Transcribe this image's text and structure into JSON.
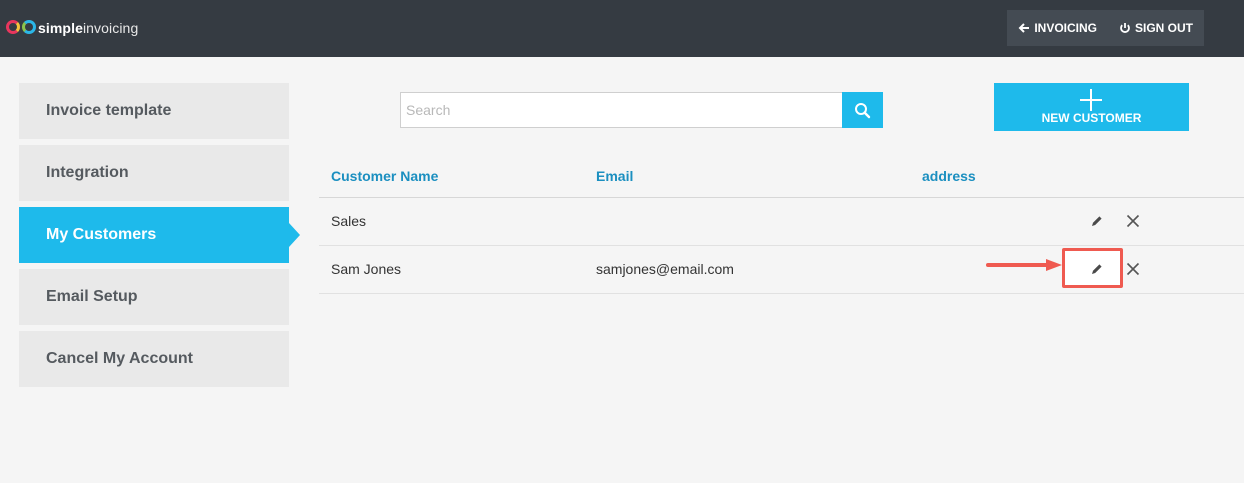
{
  "app": {
    "logo_prefix": "simple",
    "logo_suffix": "invoicing",
    "logo_mark": "GO",
    "accent_color": "#1ebaeb"
  },
  "topnav": {
    "invoicing_label": "INVOICING",
    "invoicing_icon": "arrow-left-icon",
    "signout_label": "SIGN OUT",
    "signout_icon": "power-icon"
  },
  "sidebar": {
    "items": [
      {
        "label": "Invoice template"
      },
      {
        "label": "Integration"
      },
      {
        "label": "My Customers",
        "active": true
      },
      {
        "label": "Email Setup"
      },
      {
        "label": "Cancel My Account"
      }
    ]
  },
  "search": {
    "placeholder": "Search",
    "value": ""
  },
  "new_customer_label": "NEW CUSTOMER",
  "table": {
    "columns": [
      "Customer Name",
      "Email",
      "address"
    ],
    "rows": [
      {
        "name": "Sales",
        "email": "",
        "address": ""
      },
      {
        "name": "Sam Jones",
        "email": "samjones@email.com",
        "address": ""
      }
    ]
  },
  "annotation": {
    "color": "#ef5a50"
  }
}
